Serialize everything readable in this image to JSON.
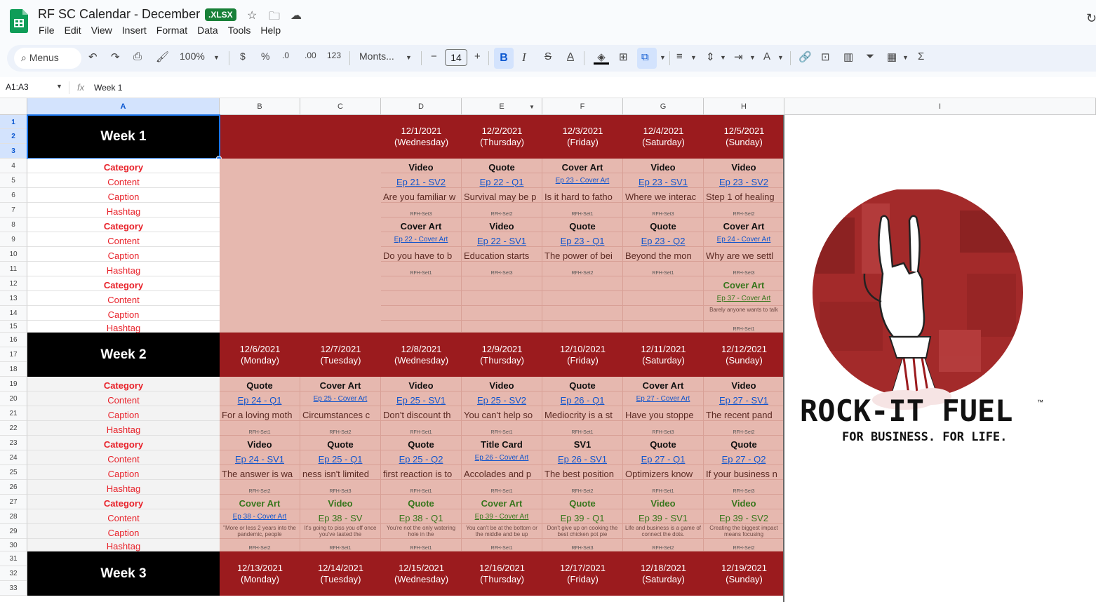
{
  "app": {
    "title": "RF SC Calendar - December",
    "badge": ".XLSX",
    "menu": [
      "File",
      "Edit",
      "View",
      "Insert",
      "Format",
      "Data",
      "Tools",
      "Help"
    ]
  },
  "toolbar": {
    "search_label": "Menus",
    "zoom": "100%",
    "currency": "$",
    "percent": "%",
    "dec_decrease": ".0",
    "dec_increase": ".00",
    "format_123": "123",
    "font": "Monts...",
    "font_size": "14",
    "minus": "−",
    "plus": "+",
    "bold": "B",
    "italic": "I",
    "strike": "S",
    "textcolor": "A",
    "sigma": "Σ"
  },
  "formula_bar": {
    "name_box": "A1:A3",
    "fx": "fx",
    "value": "Week 1"
  },
  "columns": [
    "A",
    "B",
    "C",
    "D",
    "E",
    "F",
    "G",
    "H",
    "I"
  ],
  "rows": [
    "1",
    "2",
    "3",
    "4",
    "5",
    "6",
    "7",
    "8",
    "9",
    "10",
    "11",
    "12",
    "13",
    "14",
    "15",
    "16",
    "17",
    "18",
    "19",
    "20",
    "21",
    "22",
    "23",
    "24",
    "25",
    "26",
    "27",
    "28",
    "29",
    "30",
    "31",
    "32",
    "33"
  ],
  "row_labels": [
    "Category",
    "Content",
    "Caption",
    "Hashtag"
  ],
  "weeks": [
    {
      "label": "Week 1",
      "dates": [
        {
          "col": "D",
          "date": "12/1/2021",
          "day": "(Wednesday)"
        },
        {
          "col": "E",
          "date": "12/2/2021",
          "day": "(Thursday)"
        },
        {
          "col": "F",
          "date": "12/3/2021",
          "day": "(Friday)"
        },
        {
          "col": "G",
          "date": "12/4/2021",
          "day": "(Saturday)"
        },
        {
          "col": "H",
          "date": "12/5/2021",
          "day": "(Sunday)"
        }
      ]
    },
    {
      "label": "Week 2",
      "dates": [
        {
          "col": "B",
          "date": "12/6/2021",
          "day": "(Monday)"
        },
        {
          "col": "C",
          "date": "12/7/2021",
          "day": "(Tuesday)"
        },
        {
          "col": "D",
          "date": "12/8/2021",
          "day": "(Wednesday)"
        },
        {
          "col": "E",
          "date": "12/9/2021",
          "day": "(Thursday)"
        },
        {
          "col": "F",
          "date": "12/10/2021",
          "day": "(Friday)"
        },
        {
          "col": "G",
          "date": "12/11/2021",
          "day": "(Saturday)"
        },
        {
          "col": "H",
          "date": "12/12/2021",
          "day": "(Sunday)"
        }
      ]
    },
    {
      "label": "Week 3",
      "dates": [
        {
          "col": "B",
          "date": "12/13/2021",
          "day": "(Monday)"
        },
        {
          "col": "C",
          "date": "12/14/2021",
          "day": "(Tuesday)"
        },
        {
          "col": "D",
          "date": "12/15/2021",
          "day": "(Wednesday)"
        },
        {
          "col": "E",
          "date": "12/16/2021",
          "day": "(Thursday)"
        },
        {
          "col": "F",
          "date": "12/17/2021",
          "day": "(Friday)"
        },
        {
          "col": "G",
          "date": "12/18/2021",
          "day": "(Saturday)"
        },
        {
          "col": "H",
          "date": "12/19/2021",
          "day": "(Sunday)"
        }
      ]
    }
  ],
  "week1_posts": [
    {
      "row": 4,
      "type": "cat",
      "cells": {
        "D": "Video",
        "E": "Quote",
        "F": "Cover Art",
        "G": "Video",
        "H": "Video"
      }
    },
    {
      "row": 5,
      "type": "link",
      "cells": {
        "D": "Ep 21 - SV2",
        "E": "Ep 22 - Q1",
        "F": "Ep 23 - Cover Art",
        "G": "Ep 23 - SV1",
        "H": "Ep 23 - SV2"
      },
      "small": [
        "F"
      ]
    },
    {
      "row": 6,
      "type": "cap",
      "cells": {
        "D": "Are you familiar w",
        "E": "Survival may be p",
        "F": "Is it hard to fatho",
        "G": "Where we interac",
        "H": "Step 1 of healing"
      }
    },
    {
      "row": 7,
      "type": "ht",
      "cells": {
        "D": "RFH-Set3",
        "E": "RFH-Set2",
        "F": "RFH-Set1",
        "G": "RFH-Set3",
        "H": "RFH-Set2"
      }
    },
    {
      "row": 8,
      "type": "cat",
      "cells": {
        "D": "Cover Art",
        "E": "Video",
        "F": "Quote",
        "G": "Quote",
        "H": "Cover Art"
      }
    },
    {
      "row": 9,
      "type": "link",
      "cells": {
        "D": "Ep 22 - Cover Art",
        "E": "Ep 22 - SV1",
        "F": "Ep 23 - Q1",
        "G": "Ep 23 - Q2",
        "H": "Ep 24 - Cover Art"
      },
      "small": [
        "D",
        "H"
      ]
    },
    {
      "row": 10,
      "type": "cap",
      "cells": {
        "D": "Do you have to b",
        "E": "Education starts",
        "F": "The power of bei",
        "G": "Beyond the mon",
        "H": "Why are we settl"
      }
    },
    {
      "row": 11,
      "type": "ht",
      "cells": {
        "D": "RFH-Set1",
        "E": "RFH-Set3",
        "F": "RFH-Set2",
        "G": "RFH-Set1",
        "H": "RFH-Set3"
      }
    },
    {
      "row": 12,
      "type": "catg",
      "cells": {
        "D": "",
        "E": "",
        "F": "",
        "G": "",
        "H": "Cover Art"
      }
    },
    {
      "row": 13,
      "type": "linkg",
      "cells": {
        "D": "",
        "E": "",
        "F": "",
        "G": "",
        "H": "Ep 37 - Cover Art"
      },
      "small": [
        "H"
      ]
    },
    {
      "row": 14,
      "type": "caps",
      "cells": {
        "D": "",
        "E": "",
        "F": "",
        "G": "",
        "H": "Barely anyone wants to talk"
      }
    },
    {
      "row": 15,
      "type": "ht",
      "cells": {
        "D": "",
        "E": "",
        "F": "",
        "G": "",
        "H": "RFH-Set1"
      }
    }
  ],
  "week2_posts": [
    {
      "row": 19,
      "type": "cat",
      "cells": {
        "B": "Quote",
        "C": "Cover Art",
        "D": "Video",
        "E": "Video",
        "F": "Quote",
        "G": "Cover Art",
        "H": "Video"
      }
    },
    {
      "row": 20,
      "type": "link",
      "cells": {
        "B": "Ep 24 - Q1",
        "C": "Ep 25 - Cover Art",
        "D": "Ep 25 - SV1",
        "E": "Ep 25 - SV2",
        "F": "Ep 26 - Q1",
        "G": "Ep 27 - Cover Art",
        "H": "Ep 27 - SV1"
      },
      "small": [
        "C",
        "G"
      ]
    },
    {
      "row": 21,
      "type": "cap",
      "cells": {
        "B": "For a loving moth",
        "C": "Circumstances c",
        "D": "Don't discount th",
        "E": "You can't help so",
        "F": "Mediocrity is a st",
        "G": "Have you stoppe",
        "H": "The recent pand"
      }
    },
    {
      "row": 22,
      "type": "ht",
      "cells": {
        "B": "RFH-Set1",
        "C": "RFH-Set2",
        "D": "RFH-Set1",
        "E": "RFH-Set1",
        "F": "RFH-Set1",
        "G": "RFH-Set3",
        "H": "RFH-Set2"
      }
    },
    {
      "row": 23,
      "type": "cat",
      "cells": {
        "B": "Video",
        "C": "Quote",
        "D": "Quote",
        "E": "Title Card",
        "F": "SV1",
        "G": "Quote",
        "H": "Quote"
      }
    },
    {
      "row": 24,
      "type": "link",
      "cells": {
        "B": "Ep 24 - SV1",
        "C": "Ep 25 - Q1",
        "D": "Ep 25 - Q2",
        "E": "Ep 26 - Cover Art",
        "F": "Ep 26 - SV1",
        "G": "Ep 27 - Q1",
        "H": "Ep 27 - Q2"
      },
      "small": [
        "E"
      ]
    },
    {
      "row": 25,
      "type": "cap",
      "cells": {
        "B": "The answer is wa",
        "C": "ness isn't limited",
        "D": "first reaction is to",
        "E": "Accolades and p",
        "F": "The best position",
        "G": "Optimizers know",
        "H": "If your business n"
      }
    },
    {
      "row": 26,
      "type": "ht",
      "cells": {
        "B": "RFH-Set2",
        "C": "RFH-Set3",
        "D": "RFH-Set1",
        "E": "RFH-Set1",
        "F": "RFH-Set2",
        "G": "RFH-Set1",
        "H": "RFH-Set3"
      }
    },
    {
      "row": 27,
      "type": "catg",
      "cells": {
        "B": "Cover Art",
        "C": "Video",
        "D": "Quote",
        "E": "Cover Art",
        "F": "Quote",
        "G": "Video",
        "H": "Video"
      }
    },
    {
      "row": 28,
      "type": "linkg",
      "cells": {
        "B": "Ep 38 - Cover Art",
        "C": "Ep 38 - SV",
        "D": "Ep 38 - Q1",
        "E": "Ep 39 - Cover Art",
        "F": "Ep 39 - Q1",
        "G": "Ep 39 - SV1",
        "H": "Ep 39 - SV2"
      },
      "small": [
        "B",
        "E"
      ],
      "blue": [
        "B"
      ]
    },
    {
      "row": 29,
      "type": "caps",
      "cells": {
        "B": "\"More or less 2 years into the pandemic, people",
        "C": "It's going to piss you off once you've tasted the",
        "D": "You're not the only watering hole in the",
        "E": "You can't be at the bottom or the middle and be up",
        "F": "Don't give up on cooking the best chicken pot pie",
        "G": "Life and business is a game of connect the dots.",
        "H": "Creating the biggest impact means focusing"
      }
    },
    {
      "row": 30,
      "type": "ht",
      "cells": {
        "B": "RFH-Set2",
        "C": "RFH-Set1",
        "D": "RFH-Set1",
        "E": "RFH-Set1",
        "F": "RFH-Set3",
        "G": "RFH-Set2",
        "H": "RFH-Set2"
      }
    }
  ],
  "brand": {
    "name": "ROCK-IT FUEL",
    "tagline": "FOR BUSINESS. FOR LIFE.",
    "mark": "™"
  },
  "colors": {
    "header_red": "#9b1b1e",
    "cell_pink": "#e6b8af",
    "week_black": "#000000",
    "label_red": "#e8222a",
    "green": "#38761d",
    "link_blue": "#1155cc"
  }
}
